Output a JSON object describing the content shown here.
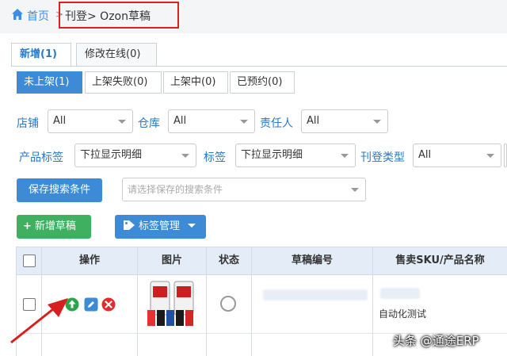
{
  "breadcrumb": {
    "home": "首页",
    "separator": ">",
    "current": "刊登> Ozon草稿"
  },
  "tabs": [
    {
      "label": "新增(1)",
      "active": true
    },
    {
      "label": "修改在线(0)",
      "active": false
    }
  ],
  "subtabs": [
    {
      "label": "未上架(1)",
      "active": true
    },
    {
      "label": "上架失败(0)",
      "active": false
    },
    {
      "label": "上架中(0)",
      "active": false
    },
    {
      "label": "已预约(0)",
      "active": false
    }
  ],
  "filters": {
    "shop": {
      "label": "店铺",
      "value": "All"
    },
    "warehouse": {
      "label": "仓库",
      "value": "All"
    },
    "owner": {
      "label": "责任人",
      "value": "All"
    },
    "product_tag": {
      "label": "产品标签",
      "value": "下拉显示明细"
    },
    "tag": {
      "label": "标签",
      "value": "下拉显示明细"
    },
    "listing_type": {
      "label": "刊登类型",
      "value": "All"
    }
  },
  "saved_search": {
    "button_label": "保存搜索条件",
    "placeholder": "请选择保存的搜索条件"
  },
  "actions": {
    "add_draft": "新增草稿",
    "tag_manage": "标签管理"
  },
  "table": {
    "headers": {
      "operation": "操作",
      "image": "图片",
      "status": "状态",
      "draft_no": "草稿编号",
      "sku_name": "售卖SKU/产品名称"
    },
    "rows": [
      {
        "product_name": "自动化测试"
      }
    ]
  },
  "watermark": "头条 @通途ERP",
  "colors": {
    "accent_blue": "#3d8ad6",
    "link_blue": "#2b78c5",
    "green": "#3eb060",
    "red_highlight": "#d7221f"
  }
}
